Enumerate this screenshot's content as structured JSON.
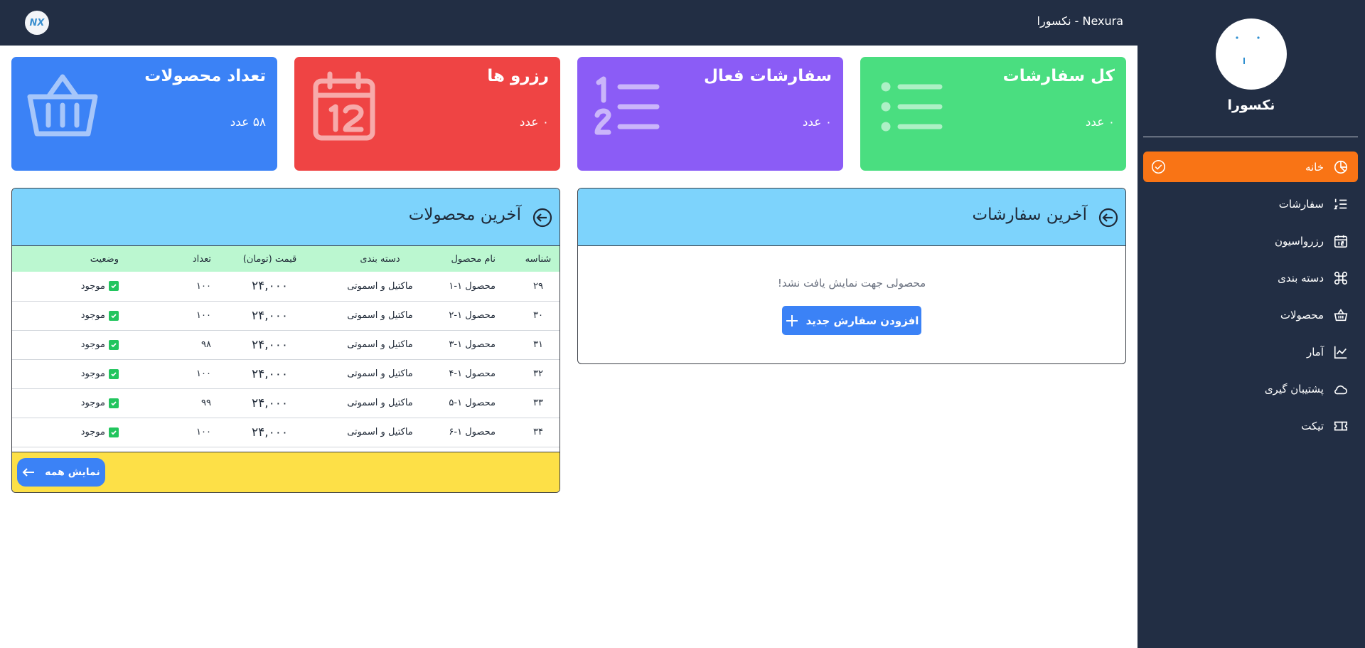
{
  "header": {
    "brand": "Nexura - نکسورا",
    "logo_text": "NX"
  },
  "sidebar": {
    "username": "نکسورا",
    "items": [
      {
        "label": "خانه",
        "icon": "pie-chart-icon",
        "active": true
      },
      {
        "label": "سفارشات",
        "icon": "numbered-list-icon"
      },
      {
        "label": "رزرواسیون",
        "icon": "calendar-icon"
      },
      {
        "label": "دسته بندی",
        "icon": "command-icon"
      },
      {
        "label": "محصولات",
        "icon": "basket-icon"
      },
      {
        "label": "آمار",
        "icon": "line-chart-icon"
      },
      {
        "label": "پشتیبان گیری",
        "icon": "cloud-icon"
      },
      {
        "label": "تیکت",
        "icon": "ticket-icon"
      }
    ]
  },
  "cards": {
    "total_orders": {
      "title": "کل سفارشات",
      "value": "۰ عدد",
      "color": "#4ade80"
    },
    "active_orders": {
      "title": "سفارشات فعال",
      "value": "۰ عدد",
      "color": "#8b5cf6"
    },
    "reservations": {
      "title": "رزرو ها",
      "value": "۰ عدد",
      "color": "#ef4444"
    },
    "products": {
      "title": "تعداد محصولات",
      "value": "۵۸ عدد",
      "color": "#3b82f6"
    }
  },
  "orders_panel": {
    "title": "آخرین سفارشات",
    "empty_message": "محصولی جهت نمایش یافت نشد!",
    "add_button": "افزودن سفارش جدید"
  },
  "products_panel": {
    "title": "آخرین محصولات",
    "columns": [
      "شناسه",
      "نام محصول",
      "دسته بندی",
      "قیمت (تومان)",
      "تعداد",
      "وضعیت"
    ],
    "rows": [
      {
        "id": "۲۹",
        "name": "محصول ۱-۱",
        "category": "ماکتیل و اسموتی",
        "price": "۲۴,۰۰۰",
        "qty": "۱۰۰",
        "status": "موجود"
      },
      {
        "id": "۳۰",
        "name": "محصول ۱-۲",
        "category": "ماکتیل و اسموتی",
        "price": "۲۴,۰۰۰",
        "qty": "۱۰۰",
        "status": "موجود"
      },
      {
        "id": "۳۱",
        "name": "محصول ۱-۳",
        "category": "ماکتیل و اسموتی",
        "price": "۲۴,۰۰۰",
        "qty": "۹۸",
        "status": "موجود"
      },
      {
        "id": "۳۲",
        "name": "محصول ۱-۴",
        "category": "ماکتیل و اسموتی",
        "price": "۲۴,۰۰۰",
        "qty": "۱۰۰",
        "status": "موجود"
      },
      {
        "id": "۳۳",
        "name": "محصول ۱-۵",
        "category": "ماکتیل و اسموتی",
        "price": "۲۴,۰۰۰",
        "qty": "۹۹",
        "status": "موجود"
      },
      {
        "id": "۳۴",
        "name": "محصول ۱-۶",
        "category": "ماکتیل و اسموتی",
        "price": "۲۴,۰۰۰",
        "qty": "۱۰۰",
        "status": "موجود"
      }
    ],
    "show_all": "نمایش همه"
  }
}
